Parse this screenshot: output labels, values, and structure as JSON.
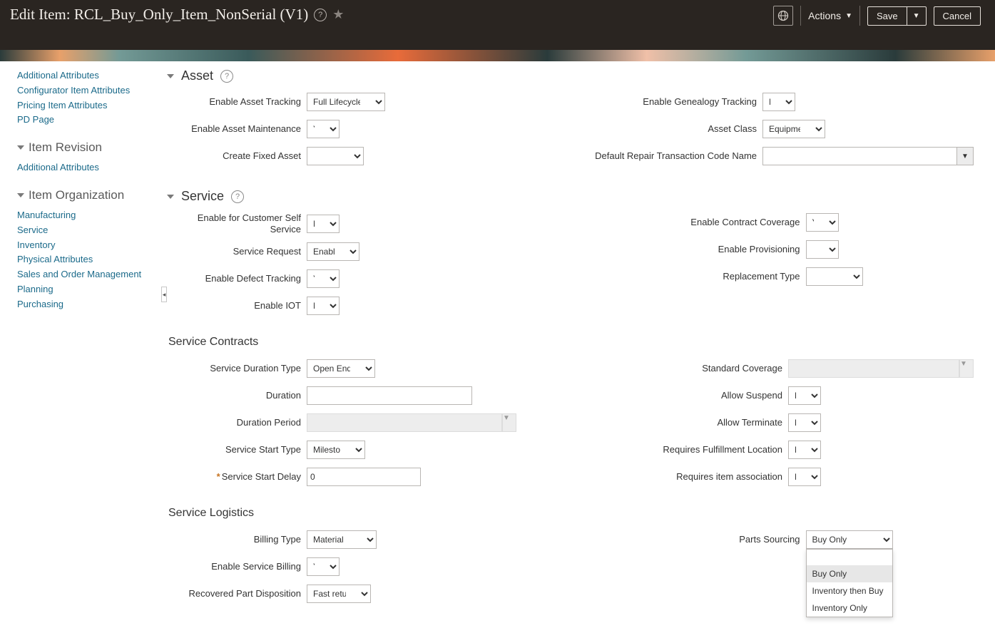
{
  "header": {
    "title": "Edit Item: RCL_Buy_Only_Item_NonSerial (V1)",
    "actions_label": "Actions",
    "save_label": "Save",
    "cancel_label": "Cancel"
  },
  "sidebar": {
    "top_links": [
      "Additional Attributes",
      "Configurator Item Attributes",
      "Pricing Item Attributes",
      "PD Page"
    ],
    "item_revision": {
      "title": "Item Revision",
      "links": [
        "Additional Attributes"
      ]
    },
    "item_org": {
      "title": "Item Organization",
      "links": [
        "Manufacturing",
        "Service",
        "Inventory",
        "Physical Attributes",
        "Sales and Order Management",
        "Planning",
        "Purchasing"
      ]
    }
  },
  "asset": {
    "title": "Asset",
    "enable_asset_tracking": {
      "label": "Enable Asset Tracking",
      "value": "Full Lifecycle"
    },
    "enable_asset_maintenance": {
      "label": "Enable Asset Maintenance",
      "value": "Yes"
    },
    "create_fixed_asset": {
      "label": "Create Fixed Asset",
      "value": ""
    },
    "enable_genealogy": {
      "label": "Enable Genealogy Tracking",
      "value": "No"
    },
    "asset_class": {
      "label": "Asset Class",
      "value": "Equipment"
    },
    "default_repair": {
      "label": "Default Repair Transaction Code Name",
      "value": ""
    }
  },
  "service": {
    "title": "Service",
    "enable_self_service": {
      "label": "Enable for Customer Self Service",
      "value": "No"
    },
    "service_request": {
      "label": "Service Request",
      "value": "Enabled"
    },
    "enable_defect": {
      "label": "Enable Defect Tracking",
      "value": "Yes"
    },
    "enable_iot": {
      "label": "Enable IOT",
      "value": "No"
    },
    "enable_contract": {
      "label": "Enable Contract Coverage",
      "value": "Yes"
    },
    "enable_provisioning": {
      "label": "Enable Provisioning",
      "value": ""
    },
    "replacement_type": {
      "label": "Replacement Type",
      "value": ""
    }
  },
  "contracts": {
    "title": "Service Contracts",
    "duration_type": {
      "label": "Service Duration Type",
      "value": "Open Ended"
    },
    "duration": {
      "label": "Duration",
      "value": ""
    },
    "duration_period": {
      "label": "Duration Period",
      "value": ""
    },
    "start_type": {
      "label": "Service Start Type",
      "value": "Milestone"
    },
    "start_delay": {
      "label": "Service Start Delay",
      "value": "0"
    },
    "standard_coverage": {
      "label": "Standard Coverage",
      "value": ""
    },
    "allow_suspend": {
      "label": "Allow Suspend",
      "value": "No"
    },
    "allow_terminate": {
      "label": "Allow Terminate",
      "value": "No"
    },
    "req_fulfillment": {
      "label": "Requires Fulfillment Location",
      "value": "No"
    },
    "req_assoc": {
      "label": "Requires item association",
      "value": "No"
    }
  },
  "logistics": {
    "title": "Service Logistics",
    "billing_type": {
      "label": "Billing Type",
      "value": "Material"
    },
    "enable_billing": {
      "label": "Enable Service Billing",
      "value": "Yes"
    },
    "recovered_part": {
      "label": "Recovered Part Disposition",
      "value": "Fast return"
    },
    "parts_sourcing": {
      "label": "Parts Sourcing",
      "value": "Buy Only",
      "options": [
        "",
        "Buy Only",
        "Inventory then Buy",
        "Inventory Only"
      ]
    }
  }
}
